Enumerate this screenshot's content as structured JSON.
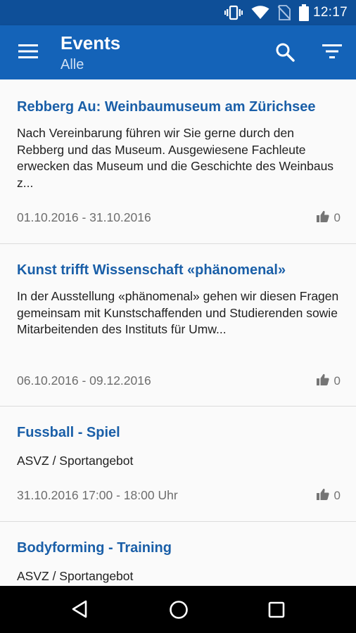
{
  "status_bar": {
    "time": "12:17",
    "icons": [
      "vibrate-icon",
      "wifi-icon",
      "no-sim-icon",
      "battery-icon"
    ]
  },
  "app_bar": {
    "title": "Events",
    "subtitle": "Alle",
    "icons": [
      "menu-icon",
      "search-icon",
      "filter-icon"
    ]
  },
  "events": [
    {
      "title": "Rebberg Au: Weinbaumuseum am Zürichsee",
      "description": "Nach Vereinbarung führen wir Sie gerne durch den Rebberg und das Museum. Ausgewiesene Fachleute erwecken das Museum und die Geschichte des Weinbaus z...",
      "date": "01.10.2016 - 31.10.2016",
      "likes": "0"
    },
    {
      "title": "Kunst trifft Wissenschaft «phänomenal»",
      "description": "In der Ausstellung «phänomenal» gehen wir diesen Fragen gemeinsam mit Kunstschaffenden und Studierenden sowie Mitarbeitenden des Instituts für Umw...",
      "date": "06.10.2016 - 09.12.2016",
      "likes": "0"
    },
    {
      "title": "Fussball - Spiel",
      "description": "ASVZ / Sportangebot",
      "date": "31.10.2016 17:00 - 18:00 Uhr",
      "likes": "0"
    },
    {
      "title": "Bodyforming - Training",
      "description": "ASVZ / Sportangebot"
    }
  ],
  "colors": {
    "status_bar": "#0e4f98",
    "app_bar": "#1463b8",
    "title_link": "#1a5fa8"
  },
  "nav_bar": {
    "icons": [
      "back-icon",
      "home-icon",
      "recents-icon"
    ]
  }
}
